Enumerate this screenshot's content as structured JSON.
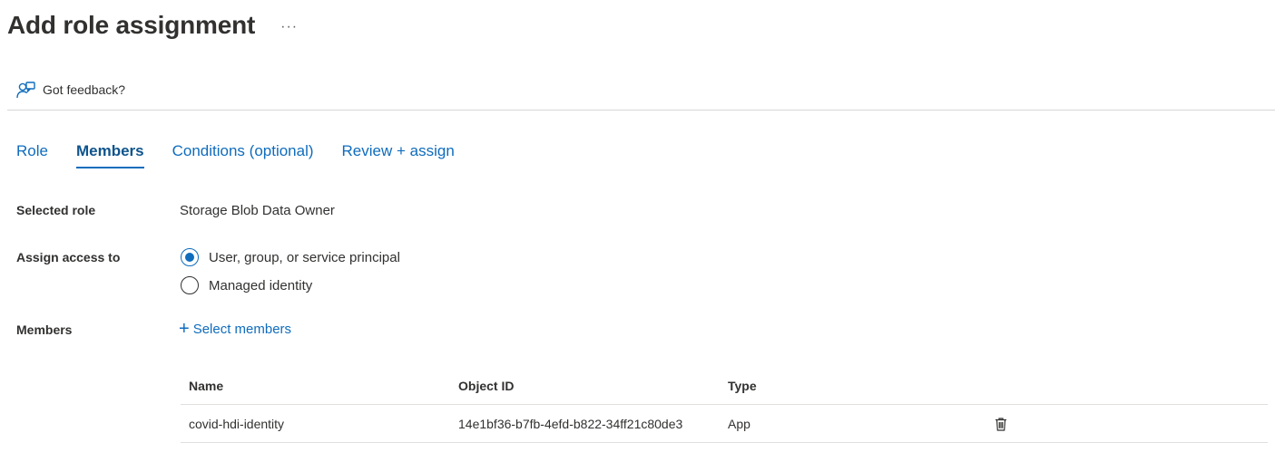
{
  "header": {
    "title": "Add role assignment",
    "more_label": "···"
  },
  "toolbar": {
    "feedback_label": "Got feedback?",
    "feedback_icon": "feedback-icon"
  },
  "tabs": [
    {
      "label": "Role",
      "active": false
    },
    {
      "label": "Members",
      "active": true
    },
    {
      "label": "Conditions (optional)",
      "active": false
    },
    {
      "label": "Review + assign",
      "active": false
    }
  ],
  "form": {
    "selected_role": {
      "label": "Selected role",
      "value": "Storage Blob Data Owner"
    },
    "assign_access": {
      "label": "Assign access to",
      "options": [
        {
          "label": "User, group, or service principal",
          "checked": true
        },
        {
          "label": "Managed identity",
          "checked": false
        }
      ]
    },
    "members": {
      "label": "Members",
      "select_label": "Select members",
      "select_icon": "plus-icon"
    }
  },
  "table": {
    "columns": [
      "Name",
      "Object ID",
      "Type"
    ],
    "rows": [
      {
        "name": "covid-hdi-identity",
        "object_id": "14e1bf36-b7fb-4efd-b822-34ff21c80de3",
        "type": "App",
        "action_icon": "trash-icon"
      }
    ]
  },
  "colors": {
    "accent": "#0f6cbd",
    "text": "#323130",
    "divider": "#d6d6d6"
  }
}
